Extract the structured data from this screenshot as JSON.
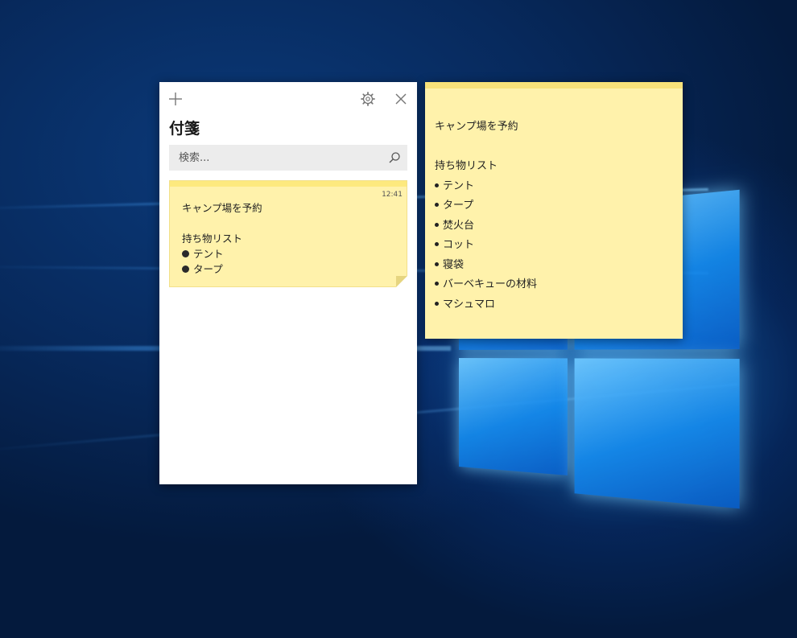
{
  "app": {
    "title": "付箋",
    "add_icon": "plus-icon",
    "settings_icon": "gear-icon",
    "close_icon": "close-icon"
  },
  "search": {
    "placeholder": "検索...",
    "value": "",
    "icon": "search-icon"
  },
  "note_list": [
    {
      "time": "12:41",
      "title_line": "キャンプ場を予約",
      "subtitle_line": "持ち物リスト",
      "bullets": [
        "テント",
        "タープ"
      ]
    }
  ],
  "open_note": {
    "title_line": "キャンプ場を予約",
    "subtitle_line": "持ち物リスト",
    "bullets": [
      "テント",
      "タープ",
      "焚火台",
      "コット",
      "寝袋",
      "バーベキューの材料",
      "マシュマロ"
    ]
  },
  "colors": {
    "note_background": "#fff2ab",
    "note_accent": "#fde97e",
    "desktop_background": "#07295c"
  }
}
